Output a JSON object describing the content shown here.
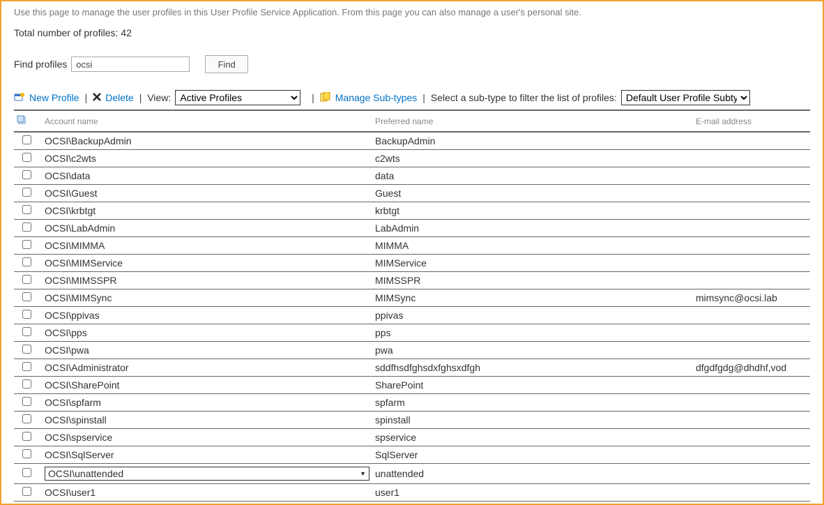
{
  "intro": "Use this page to manage the user profiles in this User Profile Service Application. From this page you can also manage a user's personal site.",
  "total_label": "Total number of profiles: 42",
  "find": {
    "label": "Find profiles",
    "value": "ocsi",
    "button": "Find"
  },
  "toolbar": {
    "new_profile": "New Profile",
    "delete": "Delete",
    "view_label": "View:",
    "view_value": "Active Profiles",
    "manage_subtypes": "Manage Sub-types",
    "subtype_filter_label": "Select a sub-type to filter the list of profiles:",
    "subtype_value": "Default User Profile Subtype"
  },
  "columns": {
    "account": "Account name",
    "preferred": "Preferred name",
    "email": "E-mail address"
  },
  "rows": [
    {
      "account": "OCSI\\BackupAdmin",
      "preferred": "BackupAdmin",
      "email": ""
    },
    {
      "account": "OCSI\\c2wts",
      "preferred": "c2wts",
      "email": ""
    },
    {
      "account": "OCSI\\data",
      "preferred": "data",
      "email": ""
    },
    {
      "account": "OCSI\\Guest",
      "preferred": "Guest",
      "email": ""
    },
    {
      "account": "OCSI\\krbtgt",
      "preferred": "krbtgt",
      "email": ""
    },
    {
      "account": "OCSI\\LabAdmin",
      "preferred": "LabAdmin",
      "email": ""
    },
    {
      "account": "OCSI\\MIMMA",
      "preferred": "MIMMA",
      "email": ""
    },
    {
      "account": "OCSI\\MIMService",
      "preferred": "MIMService",
      "email": ""
    },
    {
      "account": "OCSI\\MIMSSPR",
      "preferred": "MIMSSPR",
      "email": ""
    },
    {
      "account": "OCSI\\MIMSync",
      "preferred": "MIMSync",
      "email": "mimsync@ocsi.lab"
    },
    {
      "account": "OCSI\\ppivas",
      "preferred": "ppivas",
      "email": ""
    },
    {
      "account": "OCSI\\pps",
      "preferred": "pps",
      "email": ""
    },
    {
      "account": "OCSI\\pwa",
      "preferred": "pwa",
      "email": ""
    },
    {
      "account": "OCSI\\Administrator",
      "preferred": "sddfhsdfghsdxfghsxdfgh",
      "email": "dfgdfgdg@dhdhf,vod"
    },
    {
      "account": "OCSI\\SharePoint",
      "preferred": "SharePoint",
      "email": ""
    },
    {
      "account": "OCSI\\spfarm",
      "preferred": "spfarm",
      "email": ""
    },
    {
      "account": "OCSI\\spinstall",
      "preferred": "spinstall",
      "email": ""
    },
    {
      "account": "OCSI\\spservice",
      "preferred": "spservice",
      "email": ""
    },
    {
      "account": "OCSI\\SqlServer",
      "preferred": "SqlServer",
      "email": ""
    },
    {
      "account": "OCSI\\unattended",
      "preferred": "unattended",
      "email": "",
      "selected": true
    },
    {
      "account": "OCSI\\user1",
      "preferred": "user1",
      "email": ""
    }
  ]
}
